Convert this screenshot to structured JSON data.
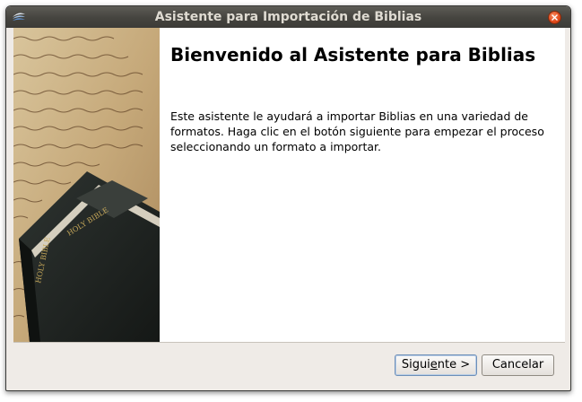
{
  "window": {
    "title": "Asistente para Importación de Biblias",
    "icon": "app-logo-icon",
    "close_icon": "close-icon"
  },
  "side_image": {
    "description_icon": "bible-book-image",
    "book_spine_text": "HOLY BIBLE",
    "book_cover_text": "HOLY BIBLE"
  },
  "content": {
    "heading": "Bienvenido al Asistente para Biblias",
    "description": "Este asistente le ayudará a importar Biblias en una variedad de formatos. Haga clic en el botón siguiente para empezar el proceso seleccionando un formato a importar."
  },
  "buttons": {
    "next_pre": "Sigui",
    "next_mnemonic": "e",
    "next_post": "nte >",
    "cancel": "Cancelar"
  },
  "colors": {
    "titlebar": "#45443f",
    "close_button": "#e0471a",
    "dialog_bg": "#efebe7"
  }
}
